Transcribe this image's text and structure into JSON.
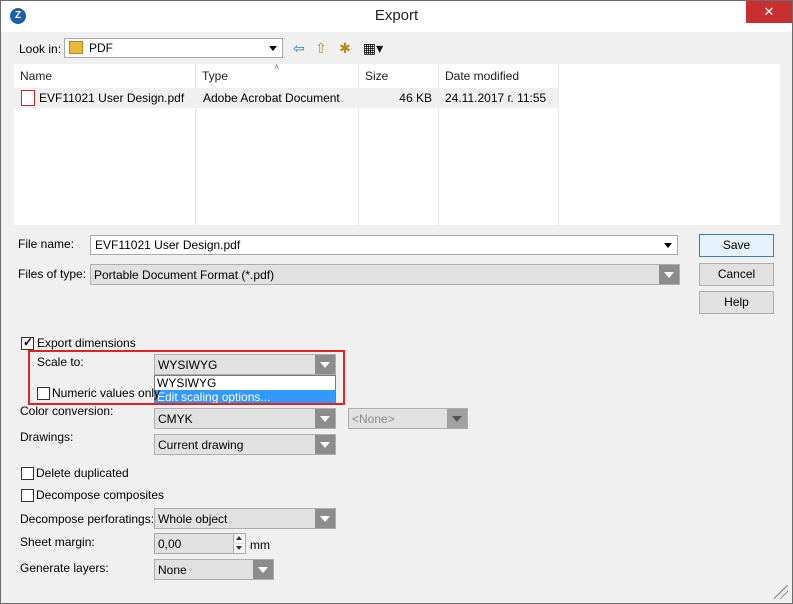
{
  "window": {
    "title": "Export",
    "close": "✕"
  },
  "lookin": {
    "label": "Look in:",
    "value": "PDF"
  },
  "filelist": {
    "columns": [
      "Name",
      "Type",
      "Size",
      "Date modified"
    ],
    "rows": [
      {
        "name": "EVF11021 User Design.pdf",
        "type": "Adobe Acrobat Document",
        "size": "46 KB",
        "date": "24.11.2017 г. 11:55"
      }
    ]
  },
  "filename": {
    "label": "File name:",
    "value": "EVF11021 User Design.pdf"
  },
  "filetype": {
    "label": "Files of type:",
    "value": "Portable Document Format (*.pdf)"
  },
  "buttons": {
    "save": "Save",
    "cancel": "Cancel",
    "help": "Help"
  },
  "options": {
    "export_dimensions": {
      "label": "Export dimensions",
      "checked": true
    },
    "scale_to": {
      "label": "Scale to:",
      "value": "WYSIWYG",
      "options": [
        "WYSIWYG",
        "Edit scaling options..."
      ]
    },
    "numeric_values_only": {
      "label": "Numeric values only",
      "checked": false
    },
    "color_conversion": {
      "label": "Color conversion:",
      "value": "CMYK",
      "secondary": "<None>"
    },
    "drawings": {
      "label": "Drawings:",
      "value": "Current drawing"
    },
    "delete_duplicated": {
      "label": "Delete duplicated",
      "checked": false
    },
    "decompose_composites": {
      "label": "Decompose composites",
      "checked": false
    },
    "decompose_perforatings": {
      "label": "Decompose perforatings:",
      "value": "Whole object"
    },
    "sheet_margin": {
      "label": "Sheet margin:",
      "value": "0,00",
      "unit": "mm"
    },
    "generate_layers": {
      "label": "Generate layers:",
      "value": "None"
    }
  },
  "colors": {
    "highlight": "#3399ff",
    "callout": "#e52121",
    "close": "#c7302f"
  }
}
